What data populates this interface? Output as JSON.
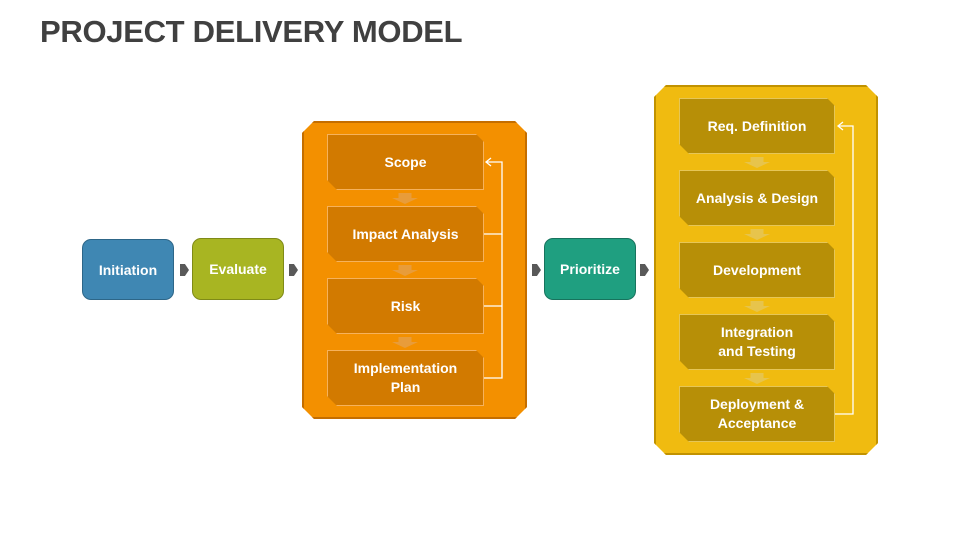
{
  "title": "PROJECT DELIVERY MODEL",
  "colors": {
    "initiation": "#3f87b3",
    "evaluate": "#a8b522",
    "prioritize": "#1f9f80",
    "planning_container": "#f39000",
    "planning_step": "#d27a00",
    "delivery_container": "#f0bb10",
    "delivery_step": "#b78f07",
    "title_text": "#404040",
    "connector_arrow": "#595959"
  },
  "flow": {
    "initiation": "Initiation",
    "evaluate": "Evaluate",
    "prioritize": "Prioritize"
  },
  "planning": {
    "steps": [
      "Scope",
      "Impact Analysis",
      "Risk",
      "Implementation Plan"
    ],
    "feedback_loop": "arrows from Impact Analysis, Risk, Implementation Plan back to Scope"
  },
  "delivery": {
    "steps": [
      "Req. Definition",
      "Analysis & Design",
      "Development",
      "Integration and Testing",
      "Deployment & Acceptance"
    ],
    "feedback_loop": "arrow from Deployment & Acceptance back to Req. Definition"
  }
}
